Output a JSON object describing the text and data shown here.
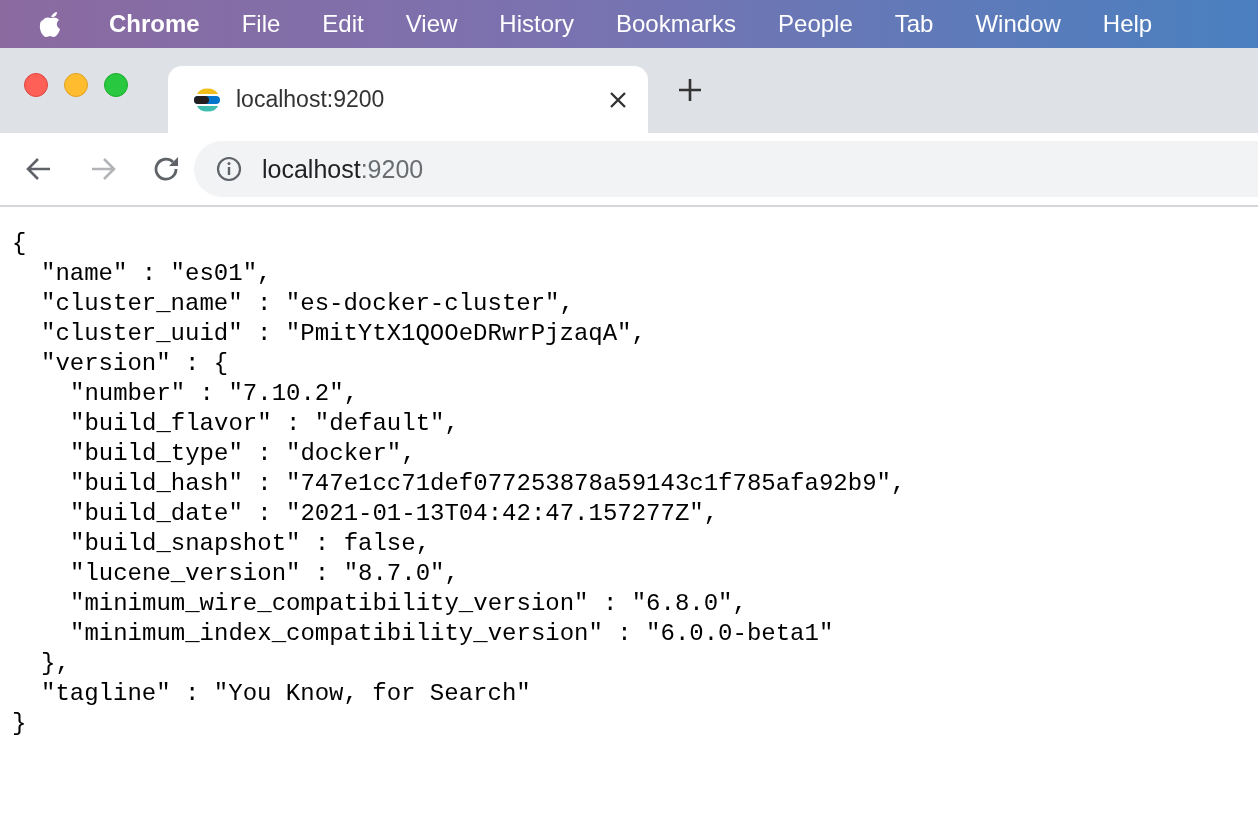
{
  "menu_bar": {
    "app_name": "Chrome",
    "menus": [
      "File",
      "Edit",
      "View",
      "History",
      "Bookmarks",
      "People",
      "Tab",
      "Window",
      "Help"
    ]
  },
  "tabs": [
    {
      "title": "localhost:9200",
      "selected": true
    }
  ],
  "nav_buttons": [
    {
      "kind": "back",
      "disabled": false
    },
    {
      "kind": "forward",
      "disabled": true
    },
    {
      "kind": "reload",
      "disabled": false
    }
  ],
  "address": {
    "host": "localhost",
    "port": ":9200"
  },
  "document": [
    {
      "text": "{",
      "close": "}",
      "children": [
        {
          "text": "\"name\" : \"es01\","
        },
        {
          "text": "\"cluster_name\" : \"es-docker-cluster\","
        },
        {
          "text": "\"cluster_uuid\" : \"PmitYtX1QOOeDRwrPjzaqA\","
        },
        {
          "text": "\"version\" : {",
          "close": "},",
          "children": [
            {
              "text": "\"number\" : \"7.10.2\","
            },
            {
              "text": "\"build_flavor\" : \"default\","
            },
            {
              "text": "\"build_type\" : \"docker\","
            },
            {
              "text": "\"build_hash\" : \"747e1cc71def077253878a59143c1f785afa92b9\","
            },
            {
              "text": "\"build_date\" : \"2021-01-13T04:42:47.157277Z\","
            },
            {
              "text": "\"build_snapshot\" : false,"
            },
            {
              "text": "\"lucene_version\" : \"8.7.0\","
            },
            {
              "text": "\"minimum_wire_compatibility_version\" : \"6.8.0\","
            },
            {
              "text": "\"minimum_index_compatibility_version\" : \"6.0.0-beta1\""
            }
          ]
        },
        {
          "text": "\"tagline\" : \"You Know, for Search\""
        }
      ]
    }
  ]
}
